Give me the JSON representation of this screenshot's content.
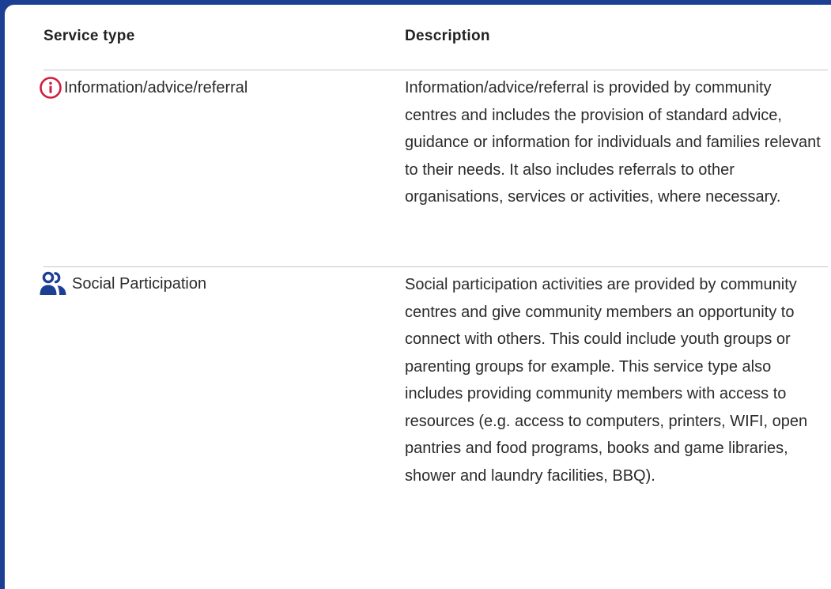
{
  "table": {
    "headers": {
      "service_type": "Service type",
      "description": "Description"
    },
    "rows": [
      {
        "icon": "info-circle-icon",
        "icon_color": "#d21d3f",
        "service_type": "Information/advice/referral",
        "description": "Information/advice/referral is provided by community centres and includes the provision of standard advice, guidance or information for individuals and families relevant to their needs. It also includes referrals to other organisations, services or activities, where necessary."
      },
      {
        "icon": "people-icon",
        "icon_color": "#1c3f94",
        "service_type": "Social Participation",
        "description": "Social participation activities are provided by community centres and give community members an opportunity to connect with others. This could include youth groups or parenting groups for example. This service type also includes providing community members with access to resources (e.g. access to computers, printers, WIFI, open pantries and food programs, books and game libraries, shower and laundry facilities, BBQ)."
      }
    ]
  },
  "colors": {
    "frame": "#1c3f94",
    "accent_red": "#d21d3f",
    "divider": "#c6c6c6"
  }
}
